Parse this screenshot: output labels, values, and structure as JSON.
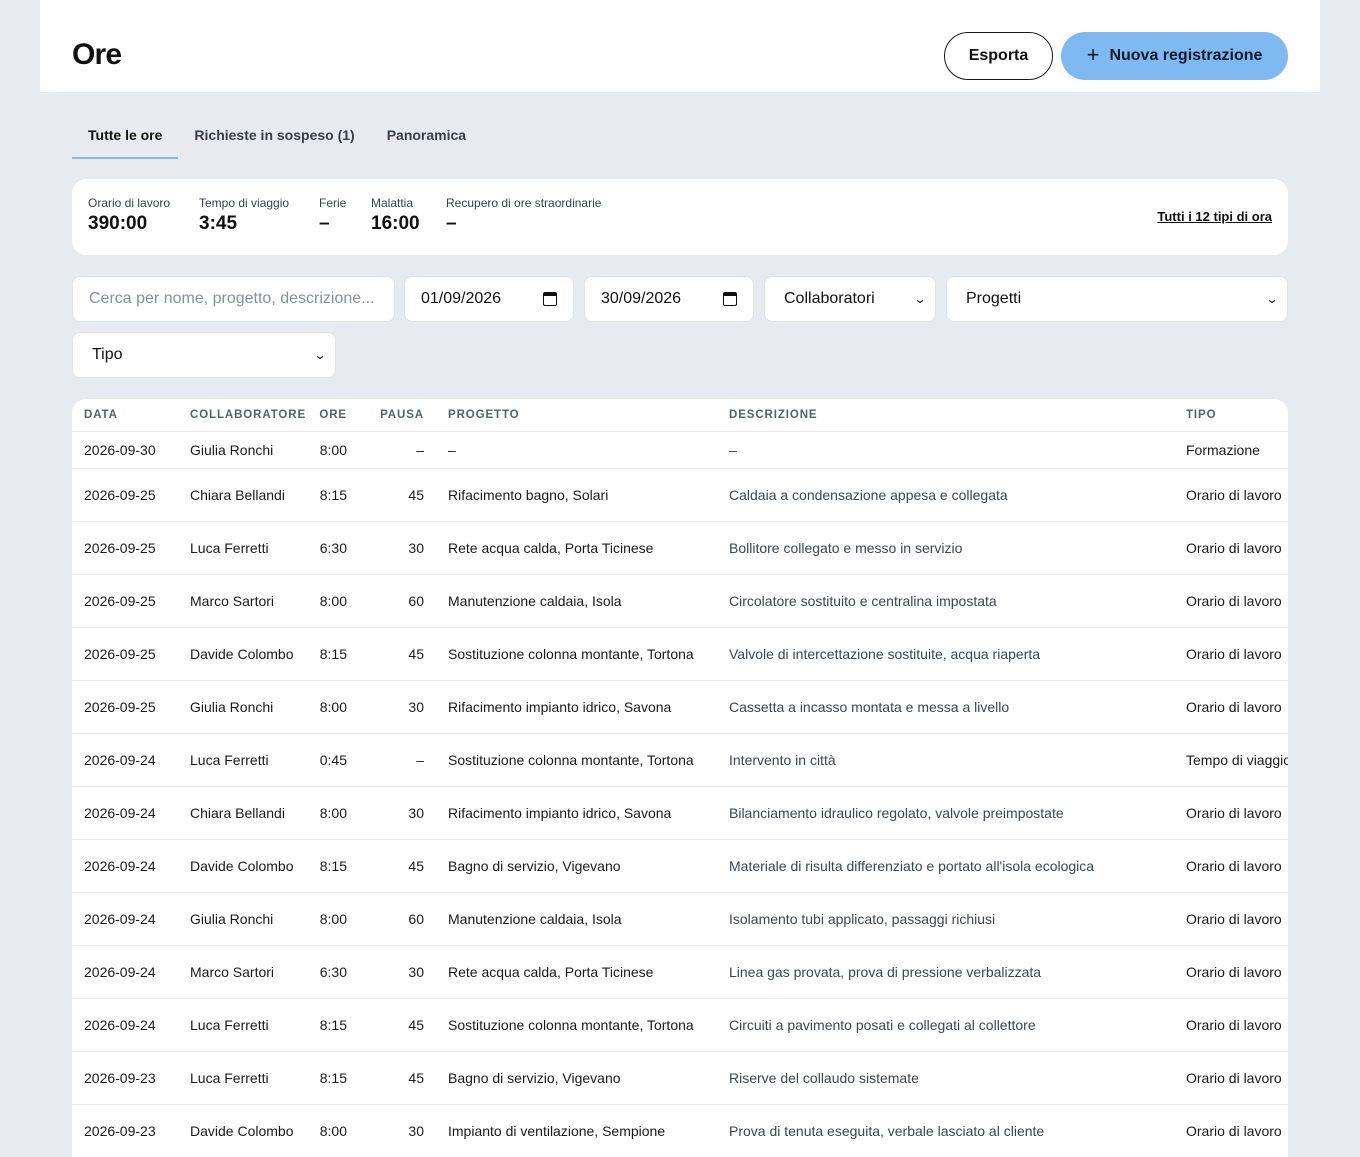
{
  "header": {
    "title": "Ore",
    "export_label": "Esporta",
    "new_label": "Nuova registrazione"
  },
  "tabs": [
    {
      "label": "Tutte le ore",
      "active": true
    },
    {
      "label": "Richieste in sospeso (1)",
      "active": false
    },
    {
      "label": "Panoramica",
      "active": false
    }
  ],
  "summary": {
    "stats": [
      {
        "label": "Orario di lavoro",
        "value": "390:00"
      },
      {
        "label": "Tempo di viaggio",
        "value": "3:45"
      },
      {
        "label": "Ferie",
        "value": "–"
      },
      {
        "label": "Malattia",
        "value": "16:00"
      },
      {
        "label": "Recupero di ore straordinarie",
        "value": "–"
      }
    ],
    "all_types_link": "Tutti i 12 tipi di ora"
  },
  "filters": {
    "search_placeholder": "Cerca per nome, progetto, descrizione...",
    "date_from": "01/09/2026",
    "date_to": "30/09/2026",
    "collaborators": "Collaboratori",
    "projects": "Progetti",
    "type": "Tipo"
  },
  "table": {
    "headers": {
      "date": "DATA",
      "collaborator": "COLLABORATORE",
      "hours": "ORE",
      "break": "PAUSA",
      "project": "PROGETTO",
      "description": "DESCRIZIONE",
      "type": "TIPO"
    },
    "rows": [
      {
        "date": "2026-09-30",
        "collaborator": "Giulia Ronchi",
        "hours": "8:00",
        "break": "–",
        "project": "–",
        "description": "–",
        "type": "Formazione"
      },
      {
        "date": "2026-09-25",
        "collaborator": "Chiara Bellandi",
        "hours": "8:15",
        "break": "45",
        "project": "Rifacimento bagno, Solari",
        "description": "Caldaia a condensazione appesa e collegata",
        "type": "Orario di lavoro"
      },
      {
        "date": "2026-09-25",
        "collaborator": "Luca Ferretti",
        "hours": "6:30",
        "break": "30",
        "project": "Rete acqua calda, Porta Ticinese",
        "description": "Bollitore collegato e messo in servizio",
        "type": "Orario di lavoro"
      },
      {
        "date": "2026-09-25",
        "collaborator": "Marco Sartori",
        "hours": "8:00",
        "break": "60",
        "project": "Manutenzione caldaia, Isola",
        "description": "Circolatore sostituito e centralina impostata",
        "type": "Orario di lavoro"
      },
      {
        "date": "2026-09-25",
        "collaborator": "Davide Colombo",
        "hours": "8:15",
        "break": "45",
        "project": "Sostituzione colonna montante, Tortona",
        "description": "Valvole di intercettazione sostituite, acqua riaperta",
        "type": "Orario di lavoro"
      },
      {
        "date": "2026-09-25",
        "collaborator": "Giulia Ronchi",
        "hours": "8:00",
        "break": "30",
        "project": "Rifacimento impianto idrico, Savona",
        "description": "Cassetta a incasso montata e messa a livello",
        "type": "Orario di lavoro"
      },
      {
        "date": "2026-09-24",
        "collaborator": "Luca Ferretti",
        "hours": "0:45",
        "break": "–",
        "project": "Sostituzione colonna montante, Tortona",
        "description": "Intervento in città",
        "type": "Tempo di viaggio"
      },
      {
        "date": "2026-09-24",
        "collaborator": "Chiara Bellandi",
        "hours": "8:00",
        "break": "30",
        "project": "Rifacimento impianto idrico, Savona",
        "description": "Bilanciamento idraulico regolato, valvole preimpostate",
        "type": "Orario di lavoro"
      },
      {
        "date": "2026-09-24",
        "collaborator": "Davide Colombo",
        "hours": "8:15",
        "break": "45",
        "project": "Bagno di servizio, Vigevano",
        "description": "Materiale di risulta differenziato e portato all'isola ecologica",
        "type": "Orario di lavoro"
      },
      {
        "date": "2026-09-24",
        "collaborator": "Giulia Ronchi",
        "hours": "8:00",
        "break": "60",
        "project": "Manutenzione caldaia, Isola",
        "description": "Isolamento tubi applicato, passaggi richiusi",
        "type": "Orario di lavoro"
      },
      {
        "date": "2026-09-24",
        "collaborator": "Marco Sartori",
        "hours": "6:30",
        "break": "30",
        "project": "Rete acqua calda, Porta Ticinese",
        "description": "Linea gas provata, prova di pressione verbalizzata",
        "type": "Orario di lavoro"
      },
      {
        "date": "2026-09-24",
        "collaborator": "Luca Ferretti",
        "hours": "8:15",
        "break": "45",
        "project": "Sostituzione colonna montante, Tortona",
        "description": "Circuiti a pavimento posati e collegati al collettore",
        "type": "Orario di lavoro"
      },
      {
        "date": "2026-09-23",
        "collaborator": "Luca Ferretti",
        "hours": "8:15",
        "break": "45",
        "project": "Bagno di servizio, Vigevano",
        "description": "Riserve del collaudo sistemate",
        "type": "Orario di lavoro"
      },
      {
        "date": "2026-09-23",
        "collaborator": "Davide Colombo",
        "hours": "8:00",
        "break": "30",
        "project": "Impianto di ventilazione, Sempione",
        "description": "Prova di tenuta eseguita, verbale lasciato al cliente",
        "type": "Orario di lavoro"
      }
    ]
  }
}
